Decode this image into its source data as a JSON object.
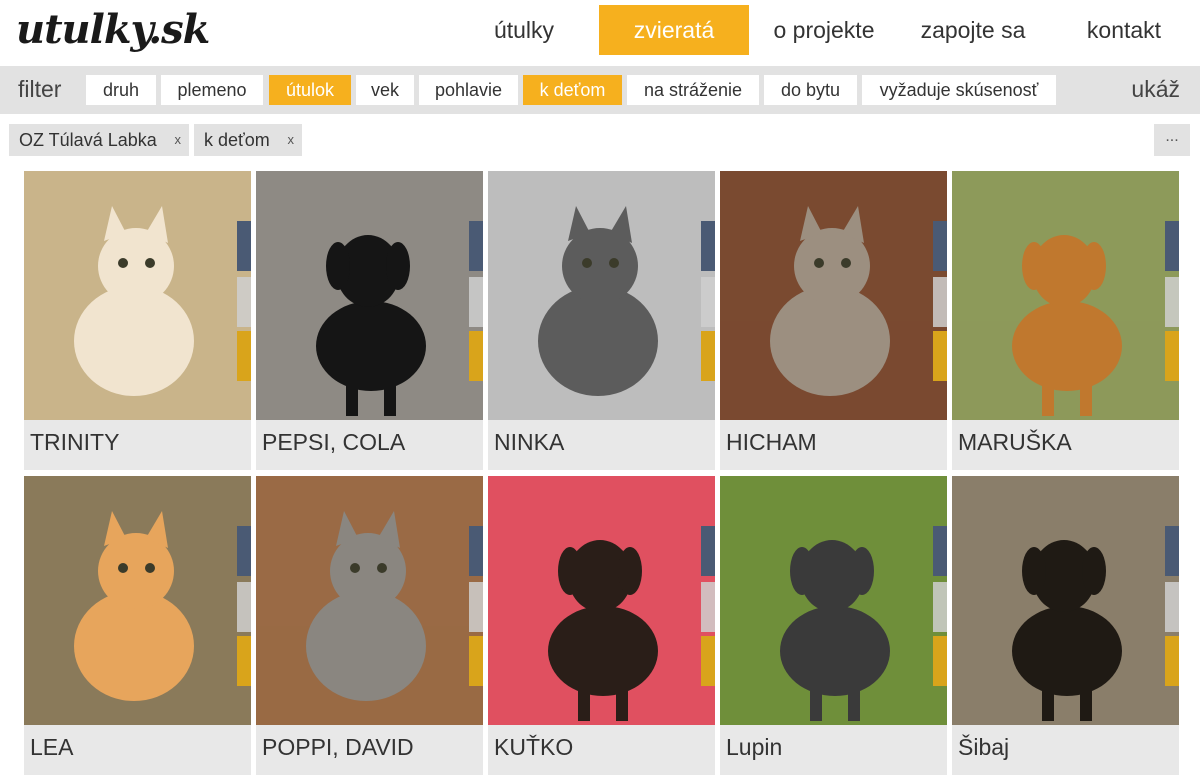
{
  "logo": "utulky.sk",
  "nav": [
    {
      "label": "útulky",
      "active": false
    },
    {
      "label": "zvieratá",
      "active": true
    },
    {
      "label": "o projekte",
      "active": false
    },
    {
      "label": "zapojte sa",
      "active": false
    },
    {
      "label": "kontakt",
      "active": false
    }
  ],
  "filter": {
    "label": "filter",
    "show_label": "ukáž",
    "chips": [
      {
        "label": "druh",
        "active": false
      },
      {
        "label": "plemeno",
        "active": false
      },
      {
        "label": "útulok",
        "active": true
      },
      {
        "label": "vek",
        "active": false
      },
      {
        "label": "pohlavie",
        "active": false
      },
      {
        "label": "k deťom",
        "active": true
      },
      {
        "label": "na stráženie",
        "active": false
      },
      {
        "label": "do bytu",
        "active": false
      },
      {
        "label": "vyžaduje skúsenosť",
        "active": false
      }
    ]
  },
  "active_tags": [
    {
      "label": "OZ Túlavá Labka",
      "remove": "x"
    },
    {
      "label": "k deťom",
      "remove": "x"
    }
  ],
  "more_label": "...",
  "animals": [
    {
      "name": "TRINITY",
      "kind": "cat",
      "bg": "#c9b48a",
      "fg": "#f1e4cf"
    },
    {
      "name": "PEPSI, COLA",
      "kind": "dog",
      "bg": "#8e8a84",
      "fg": "#151515"
    },
    {
      "name": "NINKA",
      "kind": "cat",
      "bg": "#bdbdbd",
      "fg": "#5c5c5c"
    },
    {
      "name": "HICHAM",
      "kind": "cat",
      "bg": "#7a4a30",
      "fg": "#9c8f80"
    },
    {
      "name": "MARUŠKA",
      "kind": "dog",
      "bg": "#8d9a5a",
      "fg": "#c0782e"
    },
    {
      "name": "LEA",
      "kind": "cat",
      "bg": "#8a7a5a",
      "fg": "#e7a55c"
    },
    {
      "name": "POPPI, DAVID",
      "kind": "cat",
      "bg": "#9a6a45",
      "fg": "#8a8680"
    },
    {
      "name": "KUŤKO",
      "kind": "dog",
      "bg": "#e05060",
      "fg": "#2a1e18"
    },
    {
      "name": "Lupin",
      "kind": "dog",
      "bg": "#6f8f3a",
      "fg": "#3a3a3a"
    },
    {
      "name": "Šibaj",
      "kind": "dog",
      "bg": "#8a7e6a",
      "fg": "#1f1a14"
    }
  ],
  "colors": {
    "accent": "#f6b01e",
    "bar": "#e2e2e2"
  }
}
